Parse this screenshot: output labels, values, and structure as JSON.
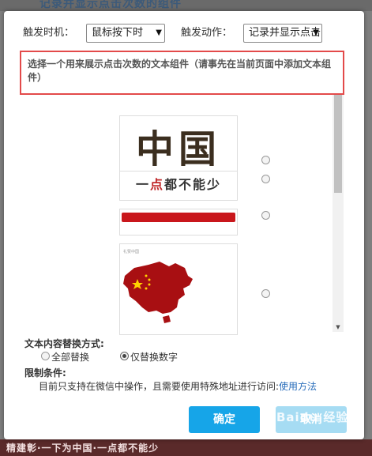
{
  "background": {
    "top_text": "记录并显示点击次数的组件",
    "bottom_text": "精建彰·一下为中国·一点都不能少"
  },
  "trigger": {
    "timing_label": "触发时机：",
    "timing_value": "鼠标按下时",
    "action_label": "触发动作：",
    "action_value": "记录并显示点击"
  },
  "instruction": "选择一个用来展示点击次数的文本组件（请事先在当前页面中添加文本组件）",
  "components": [
    {
      "text": "中国",
      "selected": false
    },
    {
      "text_a": "一",
      "text_b": "点",
      "text_c": "都不能少",
      "selected": false
    },
    {
      "selected": false
    },
    {
      "poster_caption": "礼赞中国",
      "selected": false
    }
  ],
  "replace": {
    "label": "文本内容替换方式:",
    "options": [
      {
        "text": "全部替换",
        "selected": false
      },
      {
        "text": "仅替换数字",
        "selected": true
      }
    ]
  },
  "limit": {
    "label": "限制条件:",
    "note": "目前只支持在微信中操作，且需要使用特殊地址进行访问:",
    "link": "使用方法"
  },
  "buttons": {
    "confirm": "确定",
    "cancel": "取消"
  },
  "watermark": "Baidu 经验",
  "colors": {
    "primary": "#16a5e8",
    "highlight_border": "#e34a4a",
    "link": "#2a6ebb"
  }
}
